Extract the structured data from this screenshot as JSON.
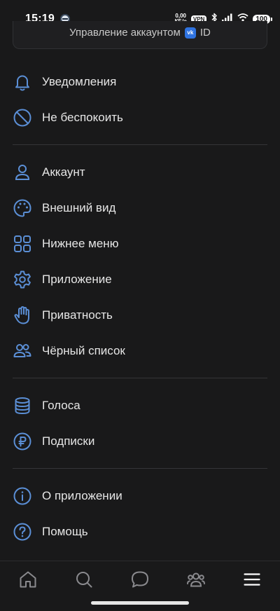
{
  "status_bar": {
    "time": "15:19",
    "net_speed_value": "0,00",
    "net_speed_unit": "КБ/с",
    "vpn": "VPN",
    "battery": "100"
  },
  "account_card": {
    "label": "Управление аккаунтом",
    "vk_badge": "vk",
    "id_text": "ID"
  },
  "menu": {
    "items": [
      {
        "label": "Уведомления",
        "icon": "bell-icon"
      },
      {
        "label": "Не беспокоить",
        "icon": "do-not-disturb-icon"
      },
      {
        "label": "Аккаунт",
        "icon": "user-icon"
      },
      {
        "label": "Внешний вид",
        "icon": "palette-icon"
      },
      {
        "label": "Нижнее меню",
        "icon": "grid-icon"
      },
      {
        "label": "Приложение",
        "icon": "gear-icon"
      },
      {
        "label": "Приватность",
        "icon": "hand-icon"
      },
      {
        "label": "Чёрный список",
        "icon": "users-icon"
      },
      {
        "label": "Голоса",
        "icon": "coins-icon"
      },
      {
        "label": "Подписки",
        "icon": "ruble-icon"
      },
      {
        "label": "О приложении",
        "icon": "info-icon"
      },
      {
        "label": "Помощь",
        "icon": "help-icon"
      }
    ]
  },
  "bottom_nav": {
    "items": [
      {
        "icon": "home-icon"
      },
      {
        "icon": "search-icon"
      },
      {
        "icon": "chat-icon"
      },
      {
        "icon": "friends-icon"
      },
      {
        "icon": "menu-icon"
      }
    ]
  },
  "colors": {
    "background": "#19191a",
    "icon_accent": "#5b8fd6",
    "text": "#e6e6e6",
    "divider": "#353538"
  }
}
